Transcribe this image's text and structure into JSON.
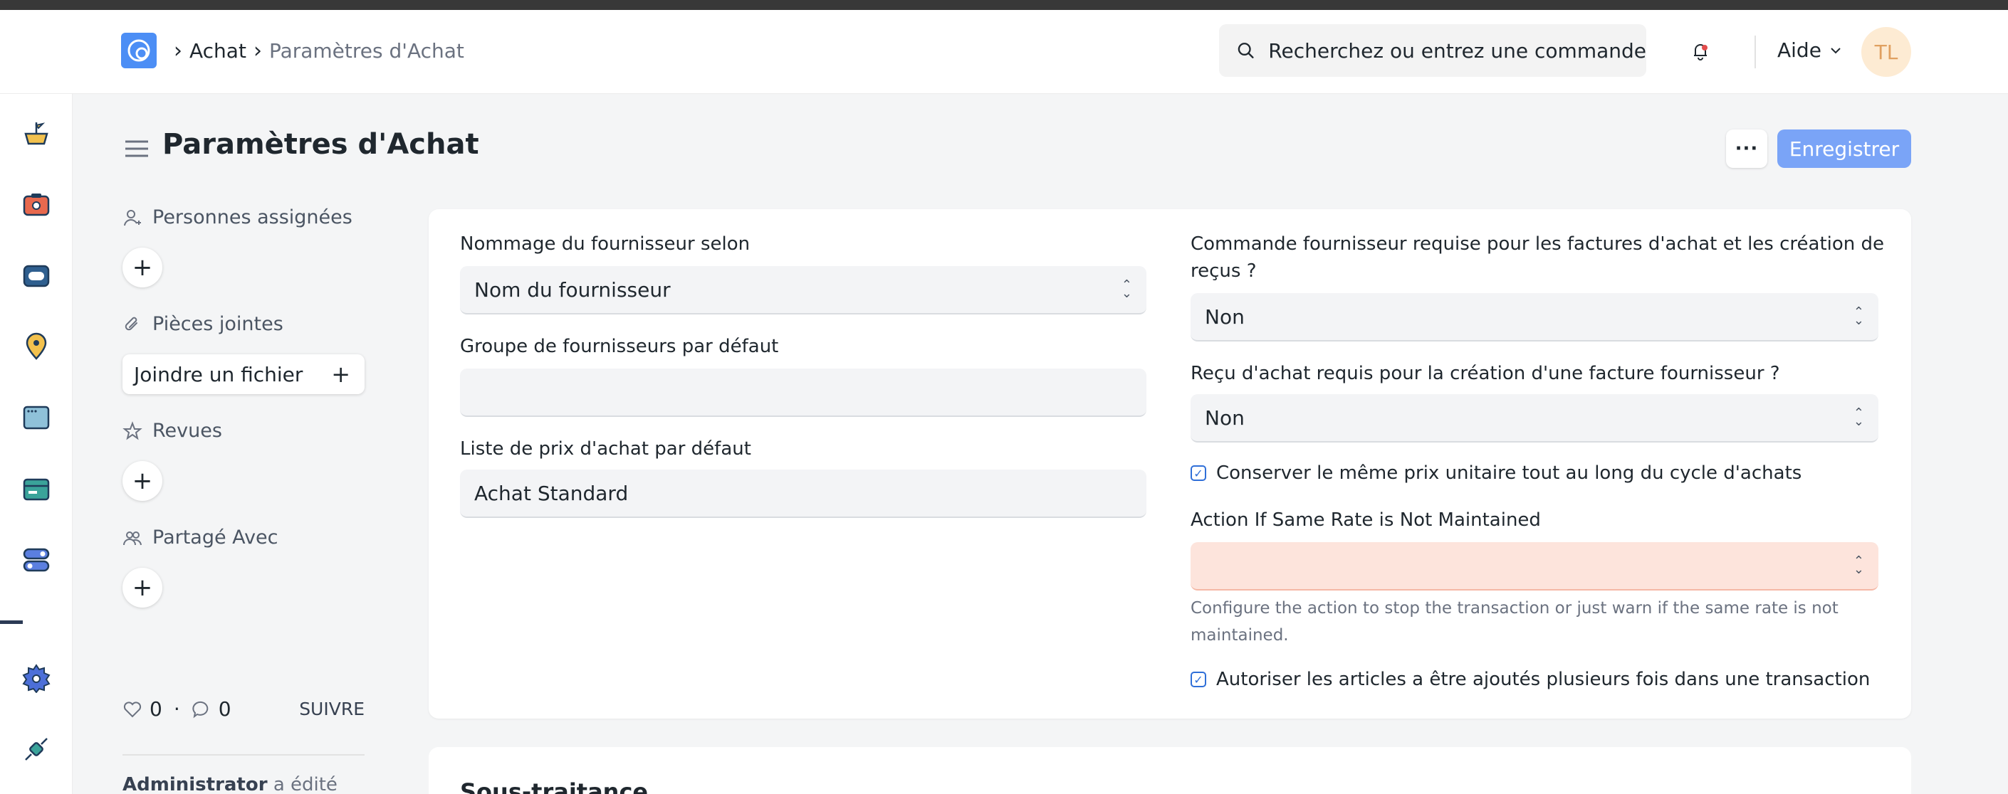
{
  "navbar": {
    "breadcrumb_parent": "Achat",
    "breadcrumb_current": "Paramètres d'Achat",
    "search_placeholder": "Recherchez ou entrez une commande",
    "help_label": "Aide",
    "avatar_initials": "TL"
  },
  "page": {
    "title": "Paramètres d'Achat",
    "more_label": "···",
    "save_label": "Enregistrer"
  },
  "sidebar": {
    "assigned_label": "Personnes assignées",
    "attachments_label": "Pièces jointes",
    "attach_file_label": "Joindre un fichier",
    "reviews_label": "Revues",
    "shared_label": "Partagé Avec",
    "likes_count": "0",
    "stats_separator": "·",
    "comments_count": "0",
    "follow_label": "SUIVRE",
    "edited_user": "Administrator",
    "edited_text": "a édité"
  },
  "form": {
    "supplier_naming_label": "Nommage du fournisseur selon",
    "supplier_naming_value": "Nom du fournisseur",
    "default_supplier_group_label": "Groupe de fournisseurs par défaut",
    "default_supplier_group_value": "",
    "default_price_list_label": "Liste de prix d'achat par défaut",
    "default_price_list_value": "Achat Standard",
    "po_required_label": "Commande fournisseur requise pour les factures d'achat et les création de reçus ?",
    "po_required_value": "Non",
    "pr_required_label": "Reçu d'achat requis pour la création d'une facture fournisseur ?",
    "pr_required_value": "Non",
    "maintain_rate_label": "Conserver le même prix unitaire tout au long du cycle d'achats",
    "maintain_rate_checked": true,
    "same_rate_action_label": "Action If Same Rate is Not Maintained",
    "same_rate_action_value": "",
    "same_rate_action_help": "Configure the action to stop the transaction or just warn if the same rate is not maintained.",
    "allow_multiple_items_label": "Autoriser les articles a être ajoutés plusieurs fois dans une transaction",
    "allow_multiple_items_checked": true
  },
  "next_section": {
    "title": "Sous-traitance"
  },
  "colors": {
    "primary": "#7aa4f7",
    "accent": "#2f6fd8",
    "warning_field": "#fde4dc"
  },
  "icons": [
    "app-logo-icon",
    "search-icon",
    "bell-icon",
    "chevron-down-icon",
    "menu-icon",
    "user-add-icon",
    "paperclip-icon",
    "star-icon",
    "users-icon",
    "heart-icon",
    "comment-icon",
    "plus-icon",
    "check-icon",
    "select-chevron-icon"
  ]
}
